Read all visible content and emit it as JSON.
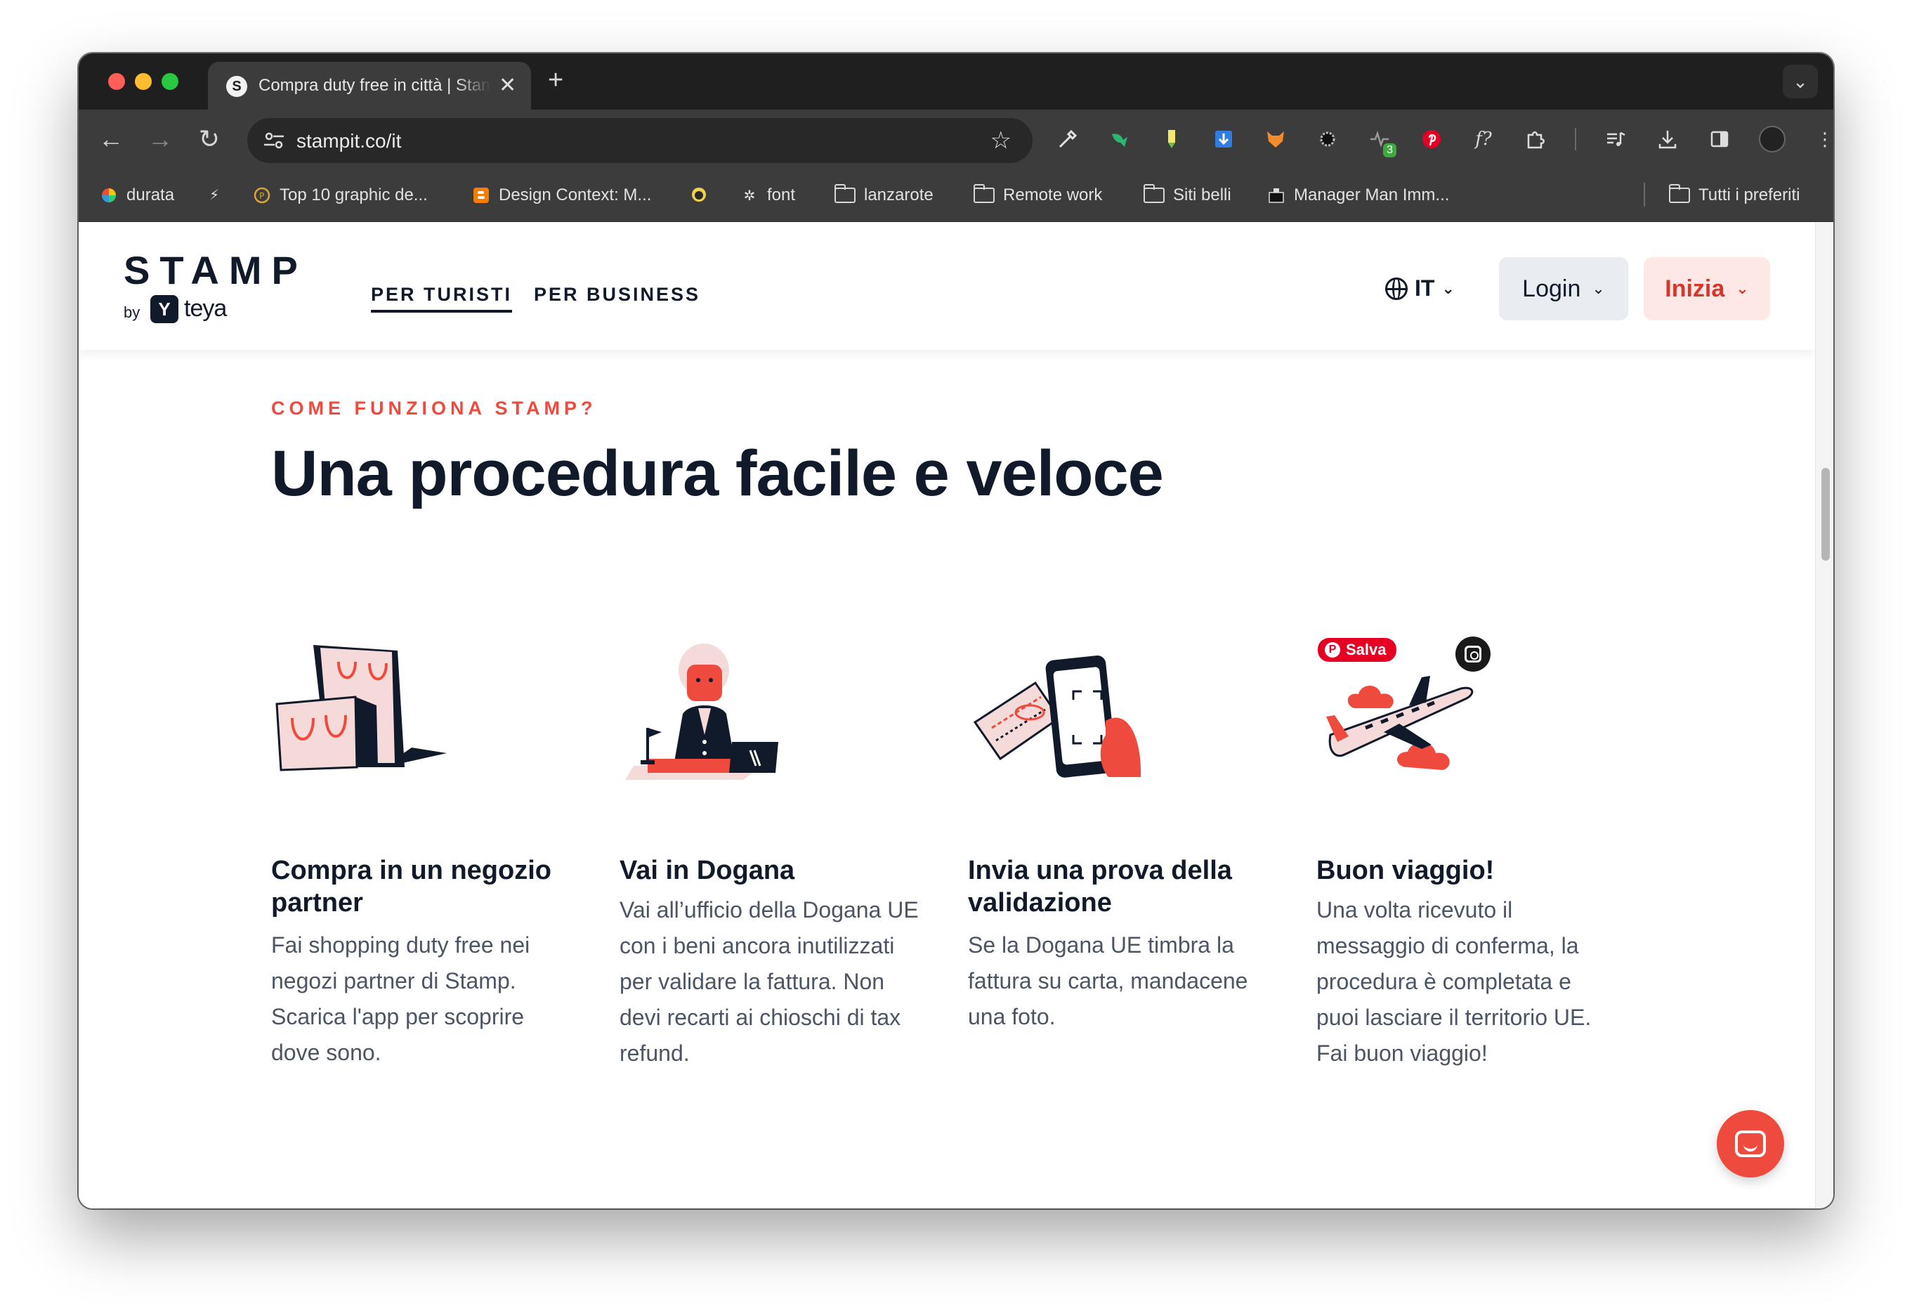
{
  "browser": {
    "tab_title": "Compra duty free in città | Stamp",
    "tab_favicon": "S",
    "tab_close": "✕",
    "new_tab": "+",
    "tab_search_icon": "chevron-down-icon",
    "url": "stampit.co/it",
    "extensions": [
      "eyedropper-icon",
      "bird-icon",
      "marker-icon",
      "download-box-icon",
      "fox-icon",
      "sun-icon",
      "pulse-icon",
      "pinterest-icon",
      "font-icon",
      "puzzle-icon"
    ],
    "extension_badge": "3",
    "bookmarks": [
      {
        "label": "durata",
        "icon": "color-ball-icon"
      },
      {
        "label": "",
        "icon": "bolt-icon"
      },
      {
        "label": "Top 10 graphic de...",
        "icon": "coin-icon"
      },
      {
        "label": "Design Context: M...",
        "icon": "blogger-icon"
      },
      {
        "label": "",
        "icon": "face-icon"
      },
      {
        "label": "font",
        "icon": "sparkle-icon"
      },
      {
        "label": "lanzarote",
        "icon": "folder-icon"
      },
      {
        "label": "Remote work",
        "icon": "folder-icon"
      },
      {
        "label": "Siti belli",
        "icon": "folder-icon"
      },
      {
        "label": "Manager Man Imm...",
        "icon": "box-icon"
      }
    ],
    "all_bookmarks": "Tutti i preferiti"
  },
  "header": {
    "logo_word": "STAMP",
    "logo_by": "by",
    "logo_mark": "Y",
    "logo_teya": "teya",
    "nav": [
      "PER TURISTI",
      "PER BUSINESS"
    ],
    "lang": "IT",
    "login": "Login",
    "start": "Inizia"
  },
  "section": {
    "eyebrow": "COME FUNZIONA STAMP?",
    "headline": "Una procedura facile e veloce",
    "steps": [
      {
        "title": "Compra in un negozio partner",
        "desc": "Fai shopping duty free nei negozi partner di Stamp. Scarica l'app per scoprire dove sono.",
        "icon": "shopping-bags-illustration"
      },
      {
        "title": "Vai in Dogana",
        "desc": "Vai all’ufficio della Dogana UE con i beni ancora inutilizzati per validare la fattura. Non devi recarti ai chioschi di tax refund.",
        "icon": "customs-officer-illustration"
      },
      {
        "title": "Invia una prova della validazione",
        "desc": "Se la Dogana UE timbra la fattura su carta, mandacene una foto.",
        "icon": "phone-receipt-illustration"
      },
      {
        "title": "Buon viaggio!",
        "desc": "Una volta ricevuto il messaggio di conferma, la procedura è completata e puoi lasciare il territorio UE. Fai buon viaggio!",
        "icon": "airplane-clouds-illustration"
      }
    ]
  },
  "overlay": {
    "pin_label": "Salva",
    "pin_icon": "pinterest-icon",
    "lens_icon": "visual-search-icon"
  },
  "colors": {
    "navy": "#101a2b",
    "coral": "#ee4b3e",
    "pink": "#f5dada"
  }
}
